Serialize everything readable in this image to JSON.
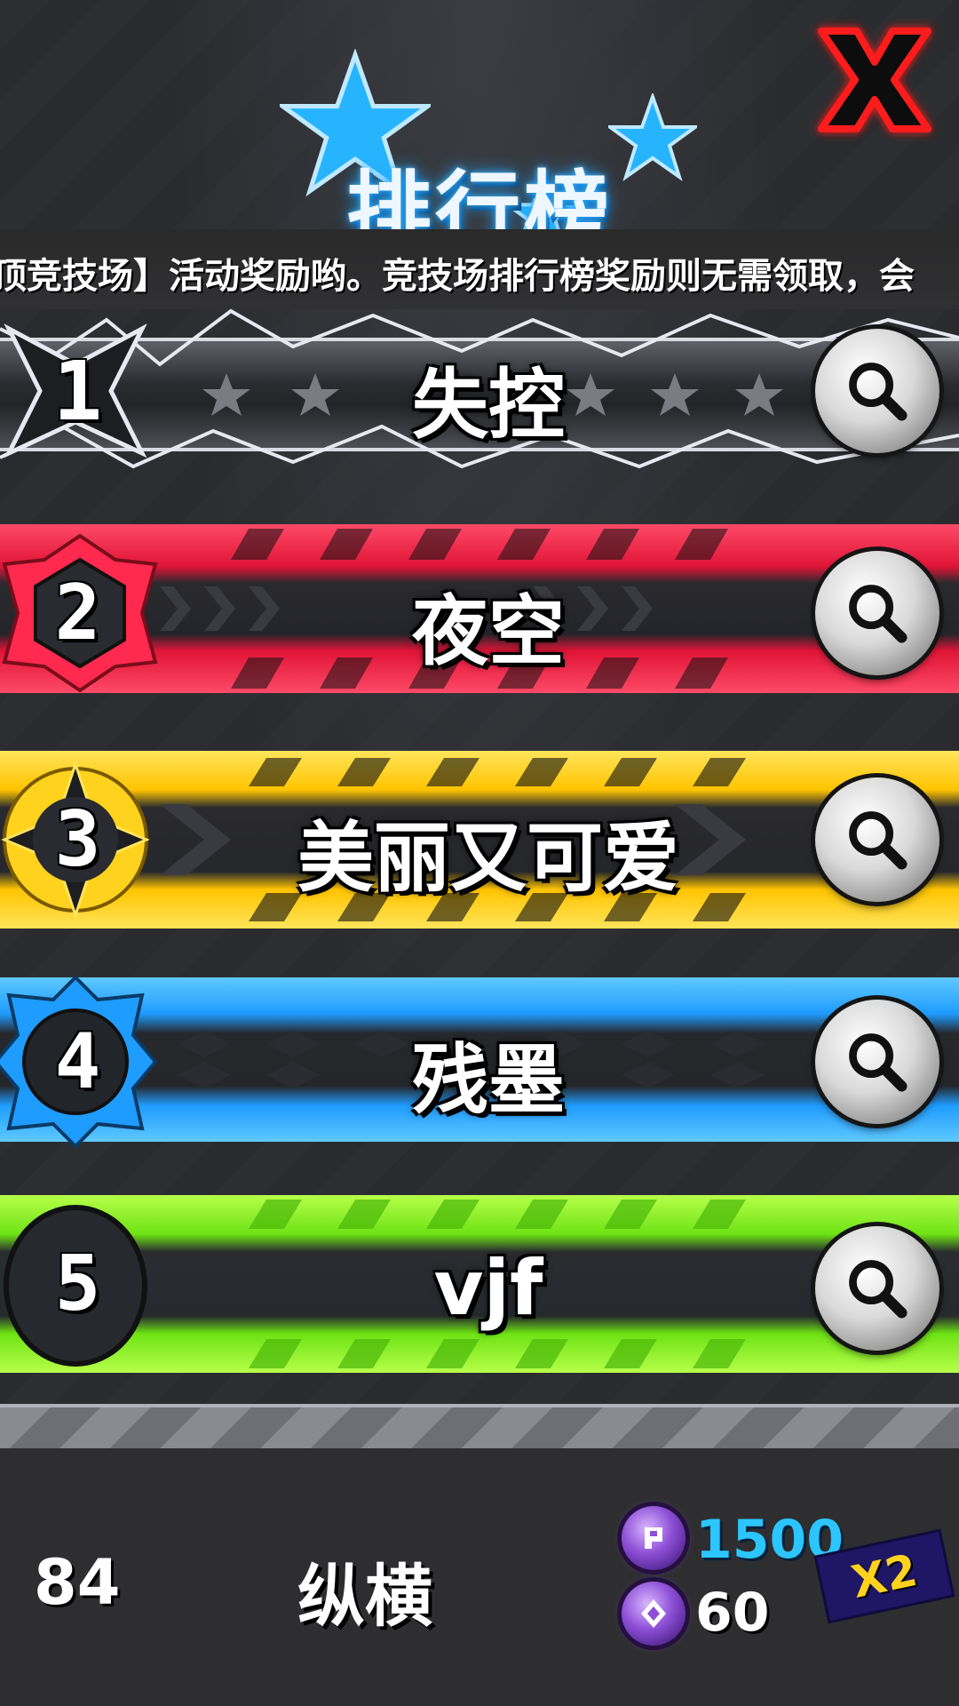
{
  "header": {
    "title": "排行榜",
    "marquee": "顶竞技场】活动奖励哟。竞技场排行榜奖励则无需领取，会"
  },
  "rankings": [
    {
      "rank": "1",
      "name": "失控",
      "theme": "silver-electric",
      "accent": "#cfd3da"
    },
    {
      "rank": "2",
      "name": "夜空",
      "theme": "crimson",
      "accent": "#ff2a4d"
    },
    {
      "rank": "3",
      "name": "美丽又可爱",
      "theme": "gold",
      "accent": "#ffd21d"
    },
    {
      "rank": "4",
      "name": "残墨",
      "theme": "azure",
      "accent": "#1fa0ff"
    },
    {
      "rank": "5",
      "name": "vjf",
      "theme": "lime",
      "accent": "#7cf21a"
    }
  ],
  "my_entry": {
    "rank": "84",
    "name": "纵横",
    "stat_primary": "1500",
    "stat_secondary": "60",
    "multiplier": "X2"
  },
  "colors": {
    "title_glow": "#1ea2ff",
    "close": "#ff1a1a",
    "stat_primary": "#2cc5ff",
    "multiplier": "#ffd21d"
  },
  "icons": {
    "close": "close-x-icon",
    "view": "magnifier-icon",
    "coin_a": "purple-coin-icon",
    "coin_b": "purple-gem-coin-icon"
  }
}
